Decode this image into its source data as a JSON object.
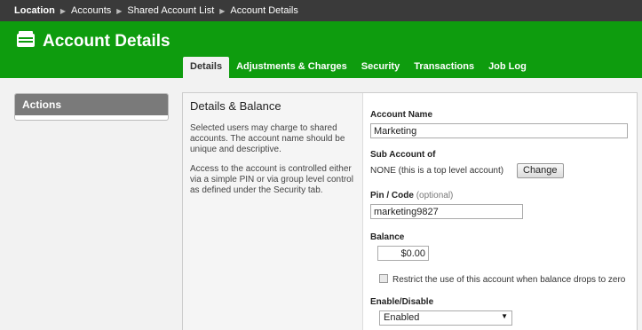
{
  "breadcrumb": {
    "items": [
      "Location",
      "Accounts",
      "Shared Account List",
      "Account Details"
    ]
  },
  "header": {
    "title": "Account Details",
    "icon": "wallet-icon",
    "brand_color": "#0e9c0e"
  },
  "tabs": [
    {
      "label": "Details",
      "active": true
    },
    {
      "label": "Adjustments & Charges",
      "active": false
    },
    {
      "label": "Security",
      "active": false
    },
    {
      "label": "Transactions",
      "active": false
    },
    {
      "label": "Job Log",
      "active": false
    }
  ],
  "actions": {
    "title": "Actions"
  },
  "details": {
    "heading": "Details & Balance",
    "para1": "Selected users may charge to shared accounts. The account name should be unique and descriptive.",
    "para2": "Access to the account is controlled either via a simple PIN or via group level control as defined under the Security tab."
  },
  "form": {
    "account_name_label": "Account Name",
    "account_name_value": "Marketing",
    "sub_account_label": "Sub Account of",
    "sub_account_value": "NONE (this is a top level account)",
    "change_button": "Change",
    "pin_label": "Pin / Code",
    "pin_optional": "(optional)",
    "pin_value": "marketing9827",
    "balance_label": "Balance",
    "balance_value": "$0.00",
    "restrict_label": "Restrict the use of this account when balance drops to zero",
    "restrict_checked": false,
    "enable_label": "Enable/Disable",
    "enable_value": "Enabled"
  }
}
